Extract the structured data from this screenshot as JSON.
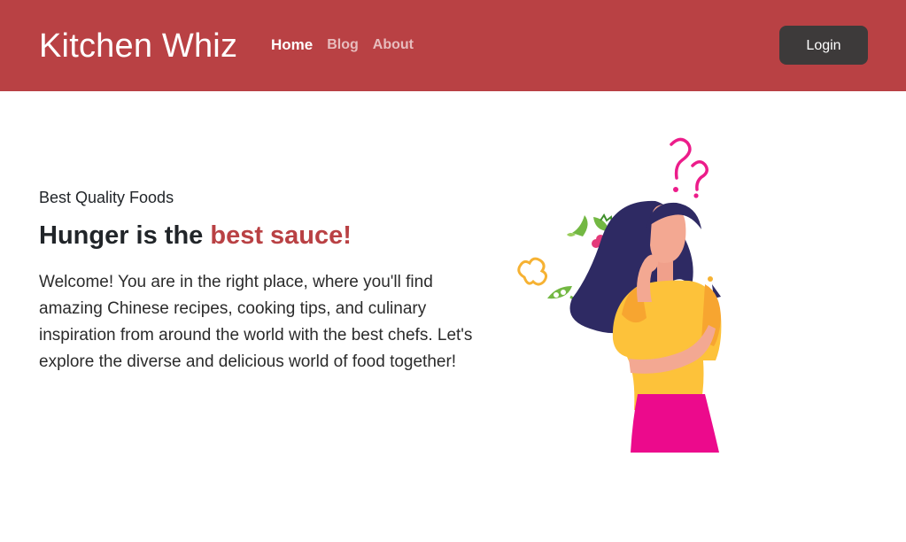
{
  "navbar": {
    "brand": "Kitchen Whiz",
    "links": [
      {
        "label": "Home",
        "active": true
      },
      {
        "label": "Blog",
        "active": false
      },
      {
        "label": "About",
        "active": false
      }
    ],
    "login_label": "Login"
  },
  "hero": {
    "eyebrow": "Best Quality Foods",
    "headline_prefix": "Hunger is the ",
    "headline_accent": "best sauce!",
    "welcome": "Welcome! You are in the right place, where you'll find amazing Chinese recipes, cooking tips, and culinary inspiration from around the world with the best chefs. Let's explore the diverse and delicious world of food together!",
    "illustration": "thinking-woman-illustration"
  },
  "colors": {
    "brand_red": "#b94144",
    "login_button": "#3d3a3a",
    "text": "#212529"
  }
}
